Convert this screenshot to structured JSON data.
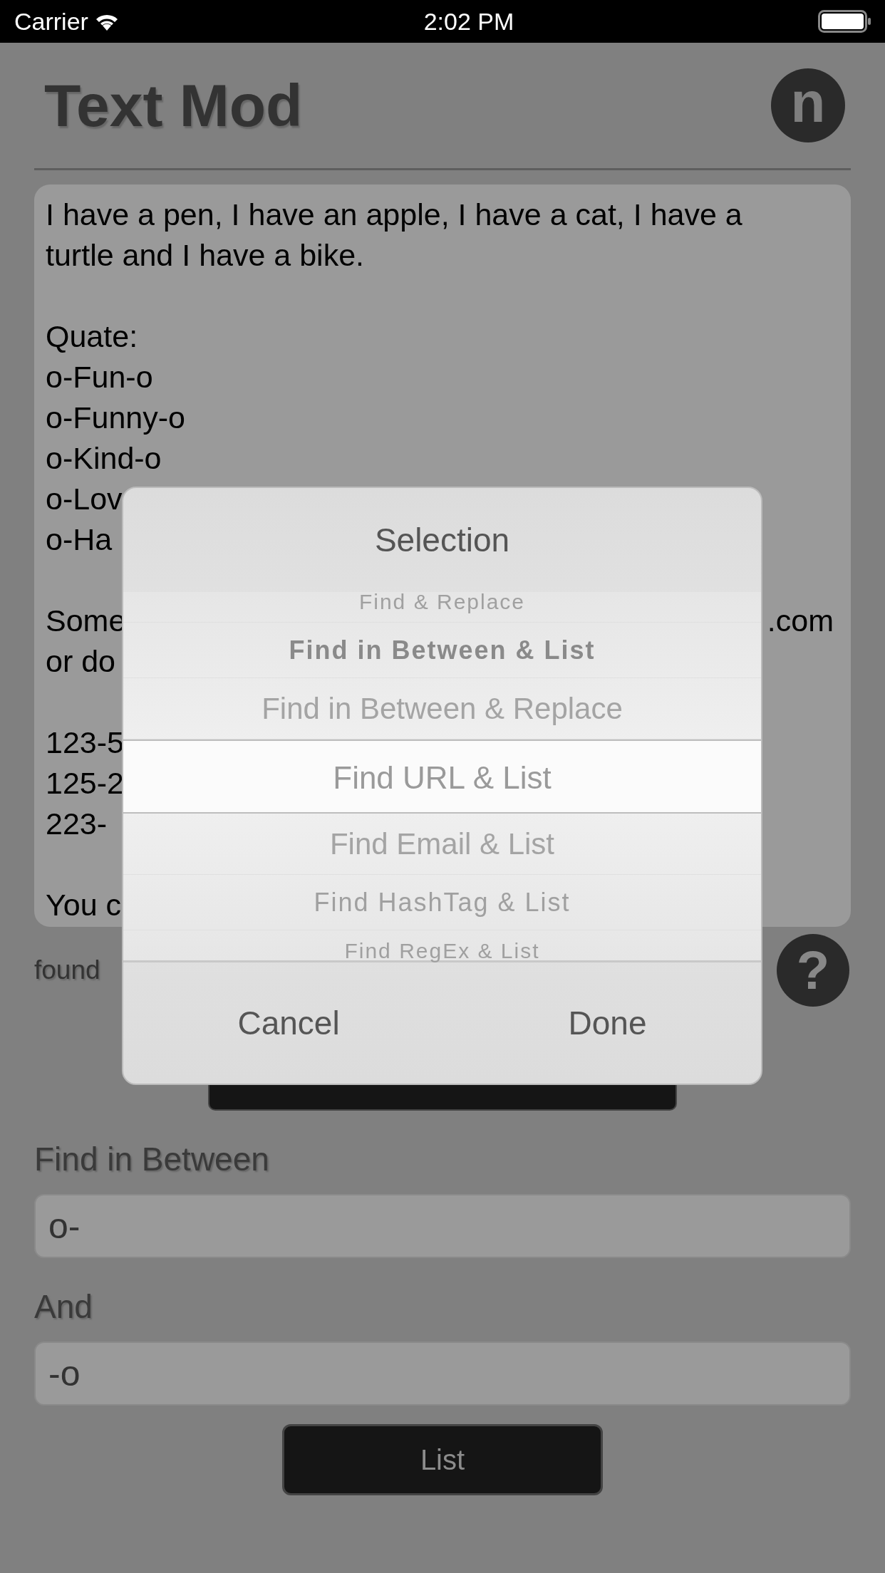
{
  "status_bar": {
    "carrier": "Carrier",
    "time": "2:02 PM"
  },
  "header": {
    "title": "Text Mod",
    "logo_letter": "n"
  },
  "text_view": {
    "lines": [
      {
        "kind": "line",
        "text": "I have a pen, I have an apple, I have a cat, I have a"
      },
      {
        "kind": "line",
        "text": "turtle and I have a bike."
      },
      {
        "kind": "blank"
      },
      {
        "kind": "line",
        "text": "Quate:"
      },
      {
        "kind": "line",
        "text": "o-Fun-o"
      },
      {
        "kind": "line",
        "text": "o-Funny-o"
      },
      {
        "kind": "line",
        "text": "o-Kind-o"
      },
      {
        "kind": "line",
        "text": "o-Lov"
      },
      {
        "kind": "line",
        "text": "o-Ha"
      },
      {
        "kind": "blank"
      },
      {
        "kind": "line",
        "text": "Some",
        "right": ".com"
      },
      {
        "kind": "line",
        "text": "or do"
      },
      {
        "kind": "blank"
      },
      {
        "kind": "line",
        "text": "123-5"
      },
      {
        "kind": "line",
        "text": "125-2"
      },
      {
        "kind": "line",
        "text": "223-"
      },
      {
        "kind": "blank"
      },
      {
        "kind": "line",
        "text": "You c"
      }
    ]
  },
  "found_label": "found",
  "help_icon": "?",
  "fields": [
    {
      "label": "Find in Between",
      "value": "o-"
    },
    {
      "label": "And",
      "value": "-o"
    }
  ],
  "list_button": "List",
  "dialog": {
    "title": "Selection",
    "options": [
      {
        "label": "Find & Replace",
        "selected": false
      },
      {
        "label": "Find in Between & List",
        "selected": false
      },
      {
        "label": "Find in Between & Replace",
        "selected": false
      },
      {
        "label": "Find URL & List",
        "selected": true
      },
      {
        "label": "Find Email & List",
        "selected": false
      },
      {
        "label": "Find HashTag & List",
        "selected": false
      },
      {
        "label": "Find RegEx & List",
        "selected": false
      }
    ],
    "buttons": [
      "Cancel",
      "Done"
    ]
  }
}
